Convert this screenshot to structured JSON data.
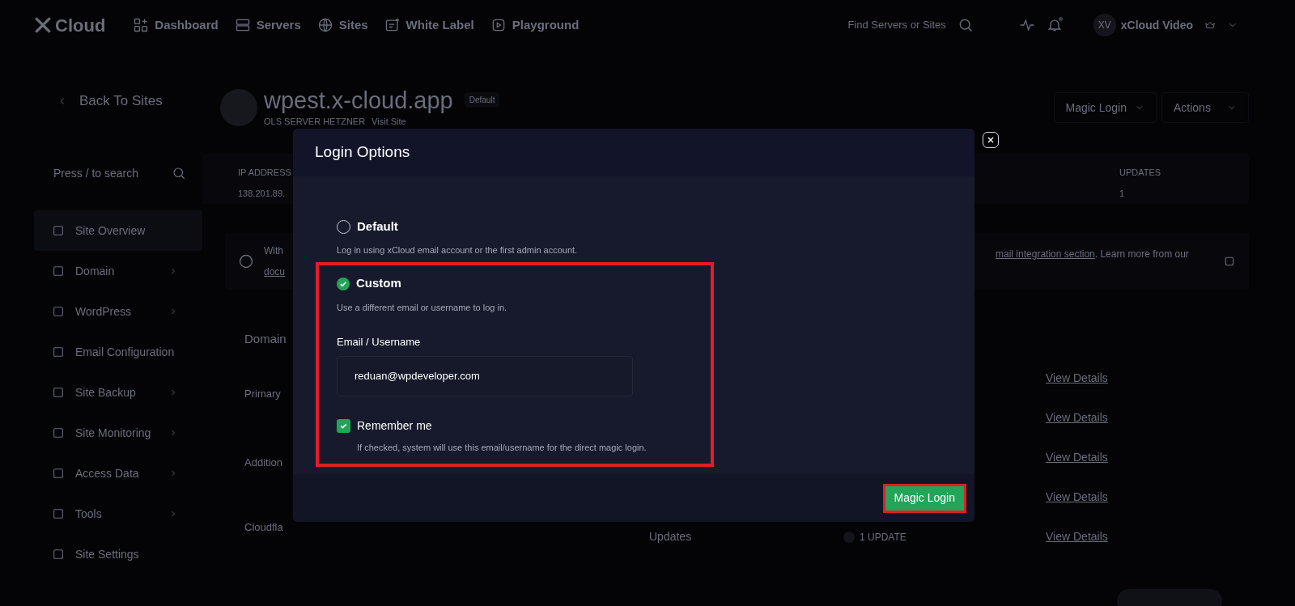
{
  "top_nav": {
    "logo": "Cloud",
    "items": [
      {
        "label": "Dashboard"
      },
      {
        "label": "Servers"
      },
      {
        "label": "Sites"
      },
      {
        "label": "White Label"
      },
      {
        "label": "Playground"
      }
    ],
    "search_placeholder": "Find Servers or Sites",
    "avatar_initials": "XV",
    "user_name": "xCloud Video"
  },
  "sidebar": {
    "back_link": "Back To Sites",
    "search_placeholder": "Press / to search",
    "items": [
      {
        "label": "Site Overview",
        "selected": true,
        "has_submenu": false
      },
      {
        "label": "Domain",
        "selected": false,
        "has_submenu": true
      },
      {
        "label": "WordPress",
        "selected": false,
        "has_submenu": true
      },
      {
        "label": "Email Configuration",
        "selected": false,
        "has_submenu": false
      },
      {
        "label": "Site Backup",
        "selected": false,
        "has_submenu": true
      },
      {
        "label": "Site Monitoring",
        "selected": false,
        "has_submenu": true
      },
      {
        "label": "Access Data",
        "selected": false,
        "has_submenu": true
      },
      {
        "label": "Tools",
        "selected": false,
        "has_submenu": true
      },
      {
        "label": "Site Settings",
        "selected": false,
        "has_submenu": false
      }
    ]
  },
  "site_header": {
    "title": "wpest.x-cloud.app",
    "badge": "Default",
    "server": "OLS SERVER HETZNER",
    "visit_link": "Visit Site",
    "buttons": [
      "Magic Login",
      "Actions"
    ]
  },
  "stats": [
    {
      "label": "IP ADDRESS",
      "value": "138.201.89."
    },
    {
      "label": "UPDATES",
      "value": "1"
    }
  ],
  "notice": {
    "text_start": "With",
    "link_start": "docu",
    "link_end": "mail integration section",
    "text_end": ". Learn more from our"
  },
  "domains": {
    "title": "Domain",
    "row_labels": [
      "Primary",
      "Addition",
      "Cloudfla"
    ],
    "updates_label": "Updates",
    "updates_badge": "1 UPDATE",
    "links": [
      "View Details",
      "View Details",
      "View Details",
      "View Details",
      "View Details"
    ]
  },
  "modal": {
    "title": "Login Options",
    "options": [
      {
        "label": "Default",
        "description": "Log in using xCloud email account or the first admin account.",
        "selected": false
      },
      {
        "label": "Custom",
        "description": "Use a different email or username to log in.",
        "selected": true
      }
    ],
    "field": {
      "label": "Email / Username",
      "value": "reduan@wpdeveloper.com"
    },
    "remember": {
      "label": "Remember me",
      "checked": true,
      "hint": "If checked, system will use this email/username for the direct magic login."
    },
    "submit": "Magic Login"
  }
}
